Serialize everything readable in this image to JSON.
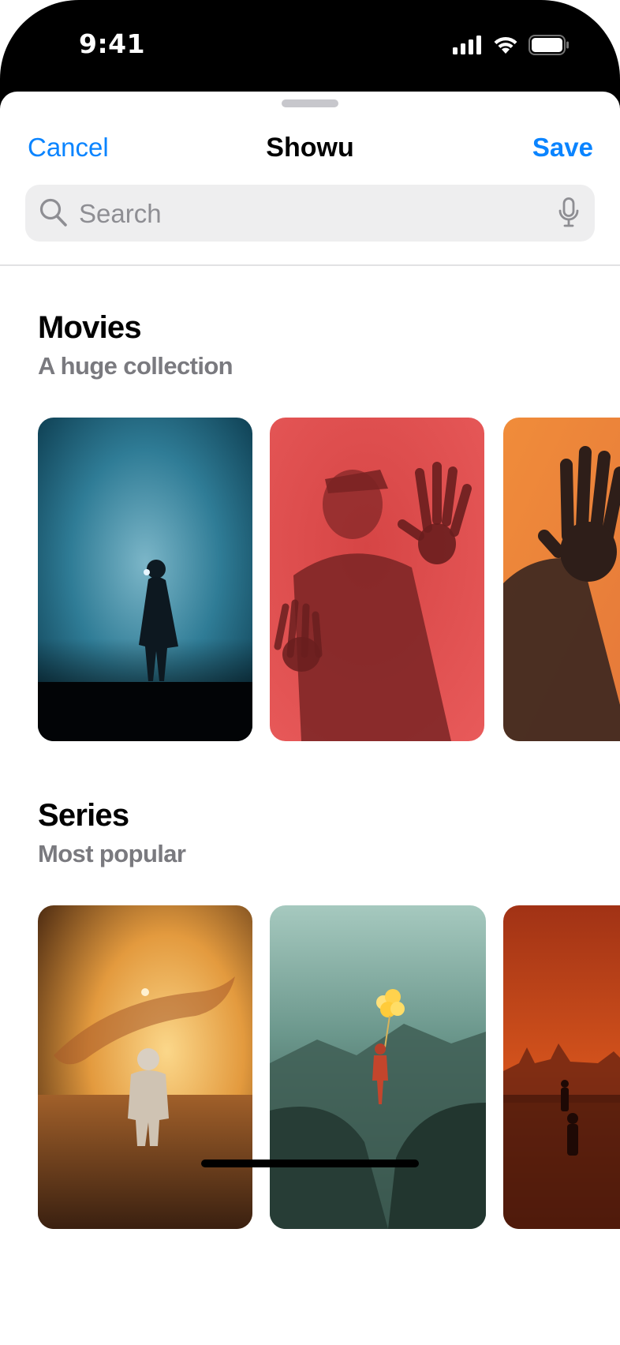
{
  "status_bar": {
    "time": "9:41"
  },
  "sheet": {
    "nav": {
      "cancel_label": "Cancel",
      "title": "Showu",
      "save_label": "Save"
    },
    "search": {
      "placeholder": "Search",
      "value": ""
    }
  },
  "sections": [
    {
      "title": "Movies",
      "subtitle": "A huge collection",
      "cards": [
        {
          "icon": "foggy-figure-blue-image"
        },
        {
          "icon": "hands-on-glass-red-image"
        },
        {
          "icon": "hand-silhouette-orange-image"
        }
      ]
    },
    {
      "title": "Series",
      "subtitle": "Most popular",
      "cards": [
        {
          "icon": "astronaut-sunset-field-image"
        },
        {
          "icon": "astronaut-balloons-valley-image"
        },
        {
          "icon": "red-city-figures-image"
        }
      ]
    }
  ],
  "colors": {
    "accent": "#0a84ff",
    "secondary_text": "#7a7a7f",
    "search_bg": "#eeeeef"
  }
}
